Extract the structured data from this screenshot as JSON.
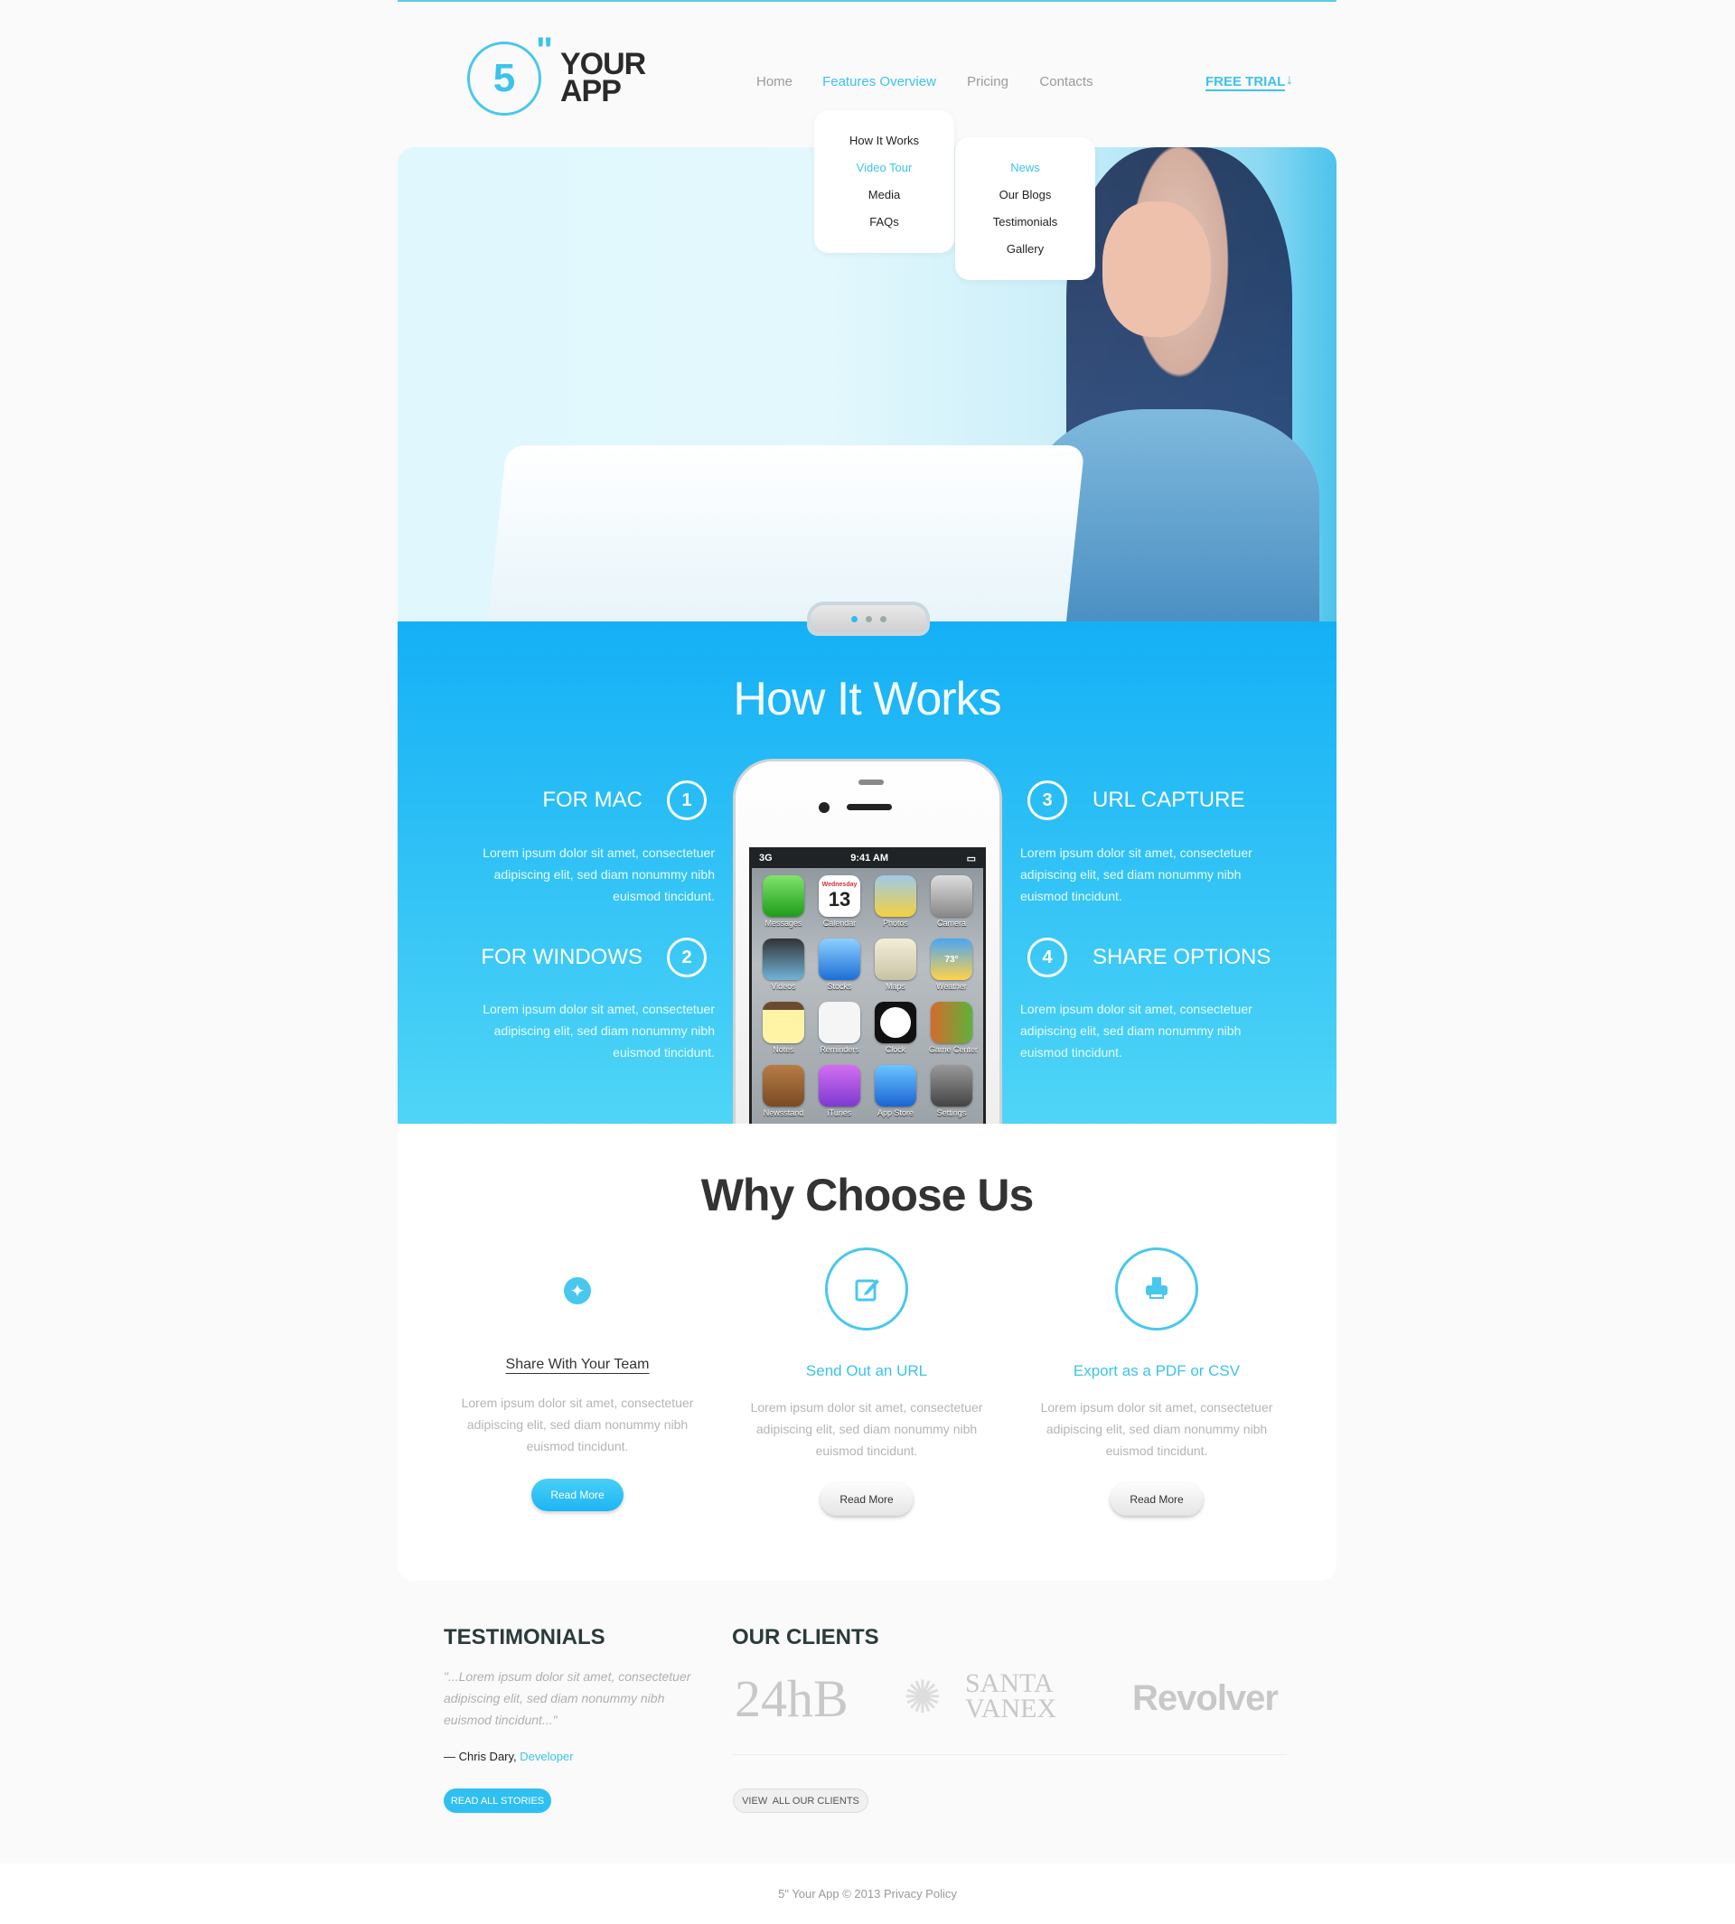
{
  "colors": {
    "accent": "#3cc3ec",
    "how_bg_top": "#14b0f6",
    "how_bg_bottom": "#4fd5f6"
  },
  "logo": {
    "number": "5",
    "quote": "\"",
    "line1": "YOUR",
    "line2": "APP"
  },
  "nav": {
    "items": [
      {
        "label": "Home"
      },
      {
        "label": "Features Overview",
        "active": true
      },
      {
        "label": "Pricing"
      },
      {
        "label": "Contacts"
      }
    ],
    "cta": "FREE TRIAL",
    "cta_icon": "arrow-down-icon"
  },
  "dropdown1": [
    {
      "label": "How It Works"
    },
    {
      "label": "Video Tour",
      "active": true
    },
    {
      "label": "Media"
    },
    {
      "label": "FAQs"
    }
  ],
  "dropdown2": [
    {
      "label": "News",
      "active": true
    },
    {
      "label": "Our Blogs"
    },
    {
      "label": "Testimonials"
    },
    {
      "label": "Gallery"
    }
  ],
  "slider": {
    "slides": 3,
    "active": 1
  },
  "how": {
    "title": "How It Works",
    "steps": [
      {
        "num": "1",
        "title": "FOR MAC",
        "text": "Lorem ipsum dolor sit amet, consectetuer adipiscing elit, sed diam nonummy nibh euismod tincidunt."
      },
      {
        "num": "2",
        "title": "FOR WINDOWS",
        "text": "Lorem ipsum dolor sit amet, consectetuer adipiscing elit, sed diam nonummy nibh euismod tincidunt."
      },
      {
        "num": "3",
        "title": "URL CAPTURE",
        "text": "Lorem ipsum dolor sit amet, consectetuer adipiscing elit, sed diam nonummy nibh euismod tincidunt."
      },
      {
        "num": "4",
        "title": "SHARE OPTIONS",
        "text": "Lorem ipsum dolor sit amet, consectetuer adipiscing elit, sed diam nonummy nibh euismod tincidunt."
      }
    ]
  },
  "phone": {
    "carrier": "3G",
    "time": "9:41 AM",
    "calendar_day": "Wednesday",
    "calendar_date": "13",
    "weather_temp": "73°",
    "apps": [
      "Messages",
      "Calendar",
      "Photos",
      "Camera",
      "Videos",
      "Stocks",
      "Maps",
      "Weather",
      "Notes",
      "Reminders",
      "Clock",
      "Game Center",
      "Newsstand",
      "iTunes",
      "App Store",
      "Settings"
    ]
  },
  "why": {
    "title": "Why Choose Us",
    "features": [
      {
        "icon": "globe-icon",
        "title": "Share With Your Team",
        "text": "Lorem ipsum dolor sit amet, consectetuer adipiscing elit, sed diam nonummy nibh euismod tincidunt.",
        "button": "Read More"
      },
      {
        "icon": "edit-icon",
        "title": "Send Out an URL",
        "text": "Lorem ipsum dolor sit amet, consectetuer adipiscing elit, sed diam nonummy nibh euismod tincidunt.",
        "button": "Read More"
      },
      {
        "icon": "printer-icon",
        "title": "Export as a PDF or CSV",
        "text": "Lorem ipsum dolor sit amet, consectetuer adipiscing elit, sed diam nonummy nibh euismod tincidunt.",
        "button": "Read More"
      }
    ]
  },
  "testimonials": {
    "title": "TESTIMONIALS",
    "quote": "\"...Lorem ipsum dolor sit amet, consectetuer adipiscing elit, sed diam nonummy nibh euismod tincidunt...\"",
    "author": "— Chris Dary,",
    "role": "Developer",
    "button": "READ ALL STORIES"
  },
  "clients": {
    "title": "OUR CLIENTS",
    "logos": [
      "24hB",
      "SANTA VANEX",
      "Revolver"
    ],
    "button": "VIEW  ALL OUR CLIENTS"
  },
  "footer": {
    "text": "5\" Your App © 2013 Privacy Policy"
  }
}
